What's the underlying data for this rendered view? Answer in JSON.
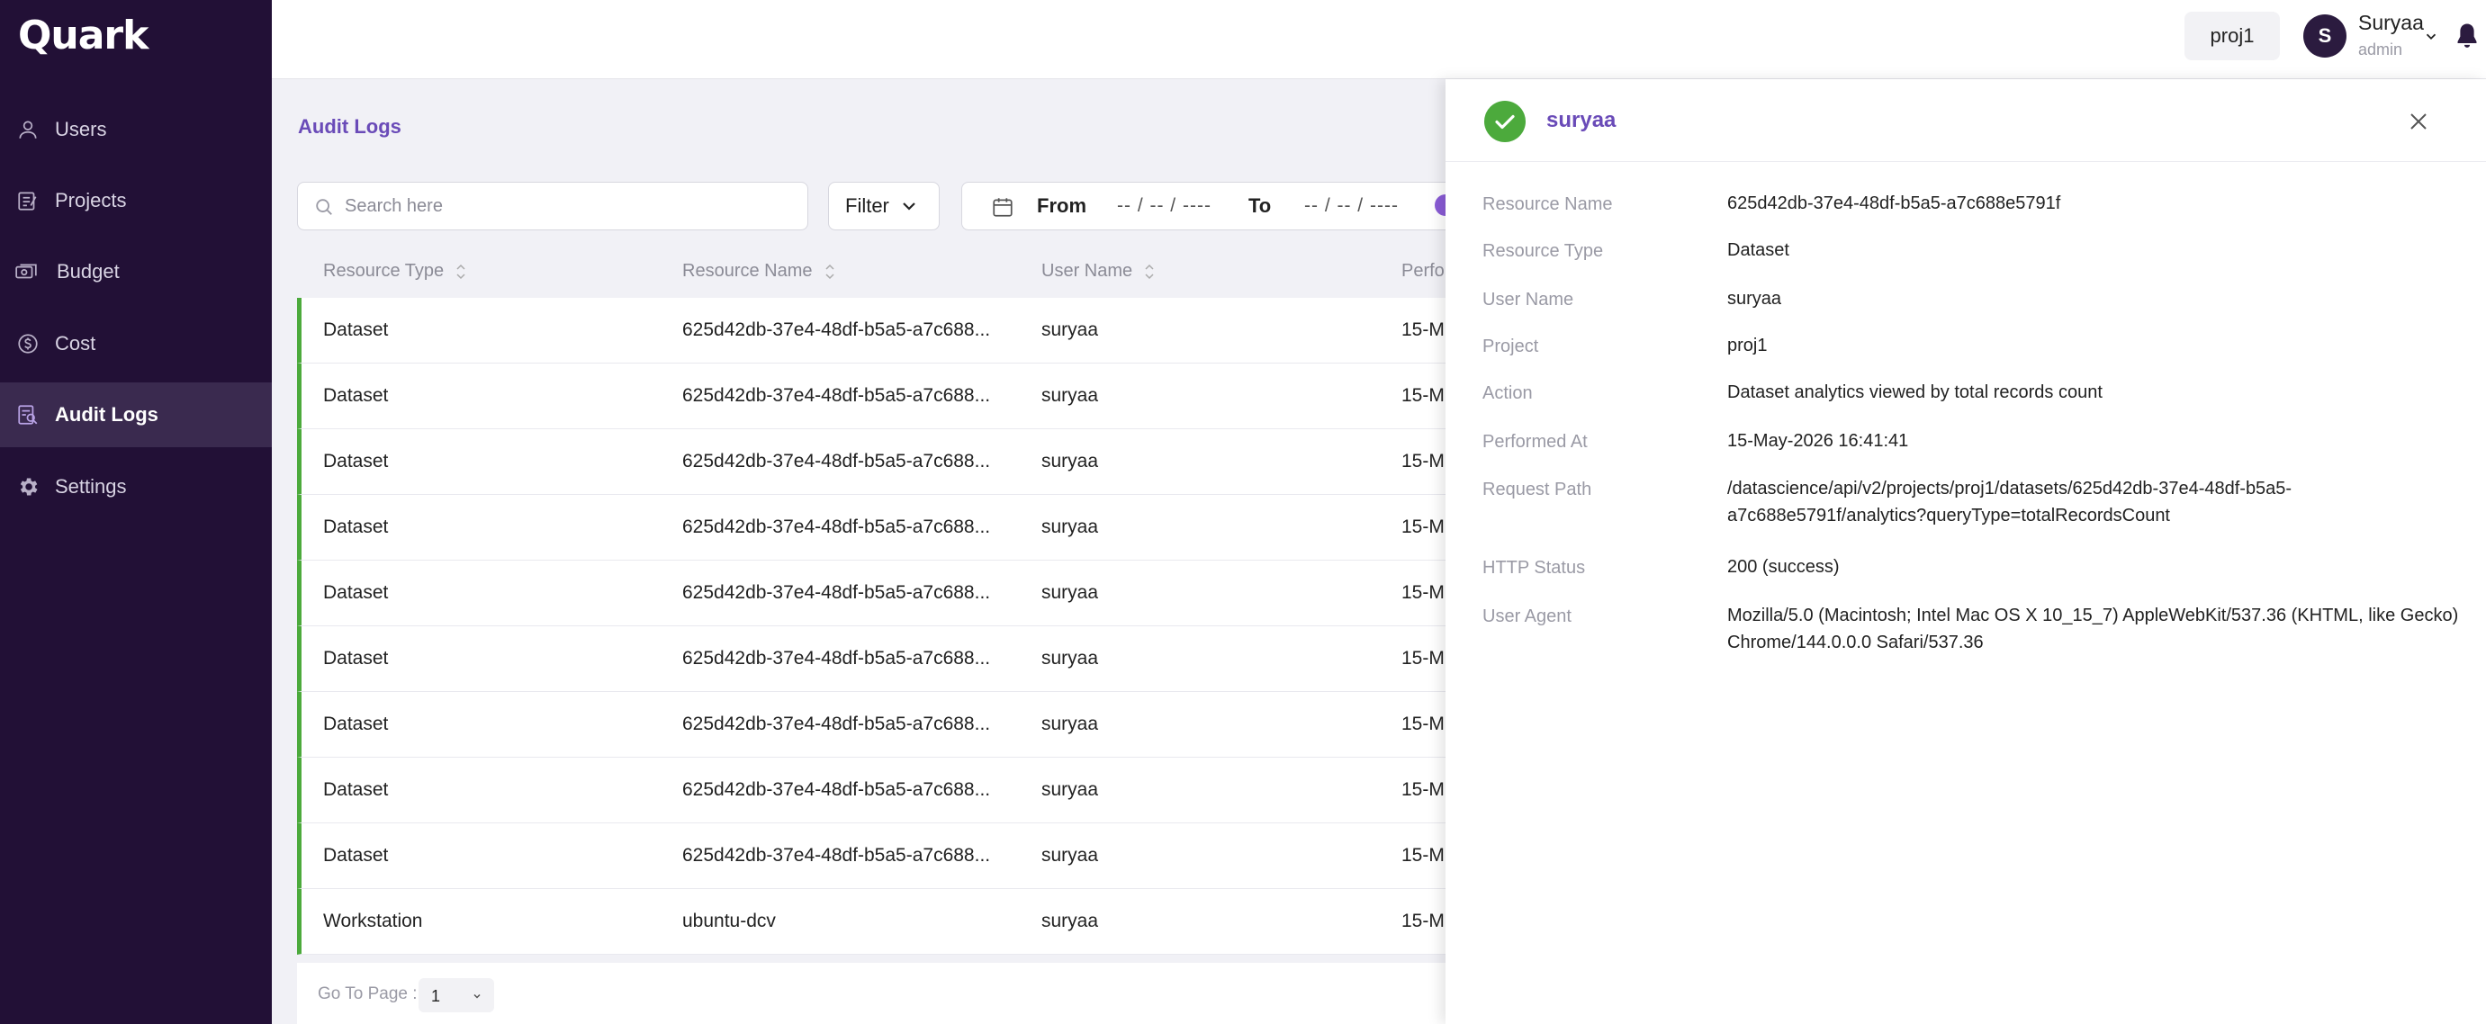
{
  "sidebar": {
    "logo": "Quark",
    "items": [
      {
        "label": "Users",
        "icon": "user-icon"
      },
      {
        "label": "Projects",
        "icon": "projects-icon"
      },
      {
        "label": "Budget",
        "icon": "budget-icon"
      },
      {
        "label": "Cost",
        "icon": "cost-icon"
      },
      {
        "label": "Audit Logs",
        "icon": "audit-logs-icon",
        "active": true
      },
      {
        "label": "Settings",
        "icon": "gear-icon"
      }
    ]
  },
  "header": {
    "project": "proj1",
    "avatar_initial": "S",
    "user_name": "Suryaa",
    "user_role": "admin"
  },
  "main": {
    "title": "Audit Logs",
    "search_placeholder": "Search here",
    "filter_label": "Filter",
    "date_from_label": "From",
    "date_from_value": "-- / -- / ----",
    "date_to_label": "To",
    "date_to_value": "-- / -- / ----",
    "columns": [
      "Resource Type",
      "Resource Name",
      "User Name",
      "Perfo"
    ],
    "rows": [
      {
        "type": "Dataset",
        "name": "625d42db-37e4-48df-b5a5-a7c688...",
        "user": "suryaa",
        "performed": "15-M"
      },
      {
        "type": "Dataset",
        "name": "625d42db-37e4-48df-b5a5-a7c688...",
        "user": "suryaa",
        "performed": "15-M"
      },
      {
        "type": "Dataset",
        "name": "625d42db-37e4-48df-b5a5-a7c688...",
        "user": "suryaa",
        "performed": "15-M"
      },
      {
        "type": "Dataset",
        "name": "625d42db-37e4-48df-b5a5-a7c688...",
        "user": "suryaa",
        "performed": "15-M"
      },
      {
        "type": "Dataset",
        "name": "625d42db-37e4-48df-b5a5-a7c688...",
        "user": "suryaa",
        "performed": "15-M"
      },
      {
        "type": "Dataset",
        "name": "625d42db-37e4-48df-b5a5-a7c688...",
        "user": "suryaa",
        "performed": "15-M"
      },
      {
        "type": "Dataset",
        "name": "625d42db-37e4-48df-b5a5-a7c688...",
        "user": "suryaa",
        "performed": "15-M"
      },
      {
        "type": "Dataset",
        "name": "625d42db-37e4-48df-b5a5-a7c688...",
        "user": "suryaa",
        "performed": "15-M"
      },
      {
        "type": "Dataset",
        "name": "625d42db-37e4-48df-b5a5-a7c688...",
        "user": "suryaa",
        "performed": "15-M"
      },
      {
        "type": "Workstation",
        "name": "ubuntu-dcv",
        "user": "suryaa",
        "performed": "15-M"
      }
    ],
    "pager_label": "Go To Page :",
    "pager_value": "1"
  },
  "drawer": {
    "title": "suryaa",
    "fields": [
      {
        "label": "Resource Name",
        "value": "625d42db-37e4-48df-b5a5-a7c688e5791f"
      },
      {
        "label": "Resource Type",
        "value": "Dataset"
      },
      {
        "label": "User Name",
        "value": "suryaa"
      },
      {
        "label": "Project",
        "value": "proj1"
      },
      {
        "label": "Action",
        "value": "Dataset analytics viewed by total records count"
      },
      {
        "label": "Performed At",
        "value": "15-May-2026 16:41:41"
      },
      {
        "label": "Request Path",
        "value": "/datascience/api/v2/projects/proj1/datasets/625d42db-37e4-48df-b5a5-a7c688e5791f/analytics?queryType=totalRecordsCount"
      },
      {
        "label": "HTTP Status",
        "value": "200 (success)"
      },
      {
        "label": "User Agent",
        "value": "Mozilla/5.0 (Macintosh; Intel Mac OS X 10_15_7) AppleWebKit/537.36 (KHTML, like Gecko) Chrome/144.0.0.0 Safari/537.36"
      }
    ]
  },
  "colors": {
    "sidebar_bg": "#221036",
    "accent": "#6a4bb8",
    "success": "#4caa3c"
  }
}
